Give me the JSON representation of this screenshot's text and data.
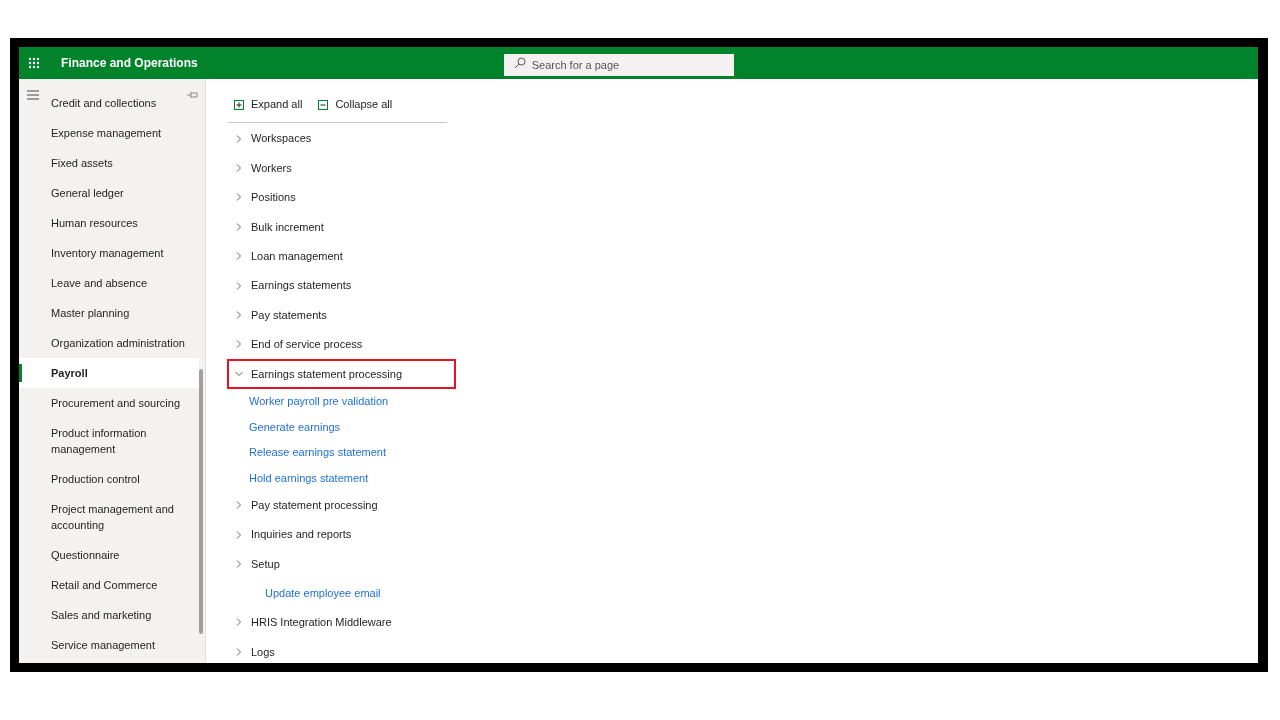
{
  "header": {
    "app_title": "Finance and Operations",
    "search": {
      "placeholder": "Search for a page"
    }
  },
  "sidebar": {
    "items": [
      {
        "label": "Credit and collections",
        "selected": false
      },
      {
        "label": "Expense management",
        "selected": false
      },
      {
        "label": "Fixed assets",
        "selected": false
      },
      {
        "label": "General ledger",
        "selected": false
      },
      {
        "label": "Human resources",
        "selected": false
      },
      {
        "label": "Inventory management",
        "selected": false
      },
      {
        "label": "Leave and absence",
        "selected": false
      },
      {
        "label": "Master planning",
        "selected": false
      },
      {
        "label": "Organization administration",
        "selected": false
      },
      {
        "label": "Payroll",
        "selected": true
      },
      {
        "label": "Procurement and sourcing",
        "selected": false
      },
      {
        "label": "Product information management",
        "selected": false
      },
      {
        "label": "Production control",
        "selected": false
      },
      {
        "label": "Project management and accounting",
        "selected": false
      },
      {
        "label": "Questionnaire",
        "selected": false
      },
      {
        "label": "Retail and Commerce",
        "selected": false
      },
      {
        "label": "Sales and marketing",
        "selected": false
      },
      {
        "label": "Service management",
        "selected": false
      }
    ]
  },
  "toolbar": {
    "expand_all": "Expand all",
    "collapse_all": "Collapse all"
  },
  "tree": [
    {
      "kind": "group",
      "label": "Workspaces",
      "expanded": false
    },
    {
      "kind": "group",
      "label": "Workers",
      "expanded": false
    },
    {
      "kind": "group",
      "label": "Positions",
      "expanded": false
    },
    {
      "kind": "group",
      "label": "Bulk increment",
      "expanded": false
    },
    {
      "kind": "group",
      "label": "Loan management",
      "expanded": false
    },
    {
      "kind": "group",
      "label": "Earnings statements",
      "expanded": false
    },
    {
      "kind": "group",
      "label": "Pay statements",
      "expanded": false
    },
    {
      "kind": "group",
      "label": "End of service process",
      "expanded": false
    },
    {
      "kind": "group",
      "label": "Earnings statement processing",
      "expanded": true,
      "highlighted": true,
      "children": [
        {
          "label": "Worker payroll pre validation"
        },
        {
          "label": "Generate earnings"
        },
        {
          "label": "Release earnings statement"
        },
        {
          "label": "Hold earnings statement"
        }
      ]
    },
    {
      "kind": "group",
      "label": "Pay statement processing",
      "expanded": false
    },
    {
      "kind": "group",
      "label": "Inquiries and reports",
      "expanded": false
    },
    {
      "kind": "group",
      "label": "Setup",
      "expanded": false
    },
    {
      "kind": "link",
      "label": "Update employee email"
    },
    {
      "kind": "group",
      "label": "HRIS Integration Middleware",
      "expanded": false
    },
    {
      "kind": "group",
      "label": "Logs",
      "expanded": false
    }
  ]
}
